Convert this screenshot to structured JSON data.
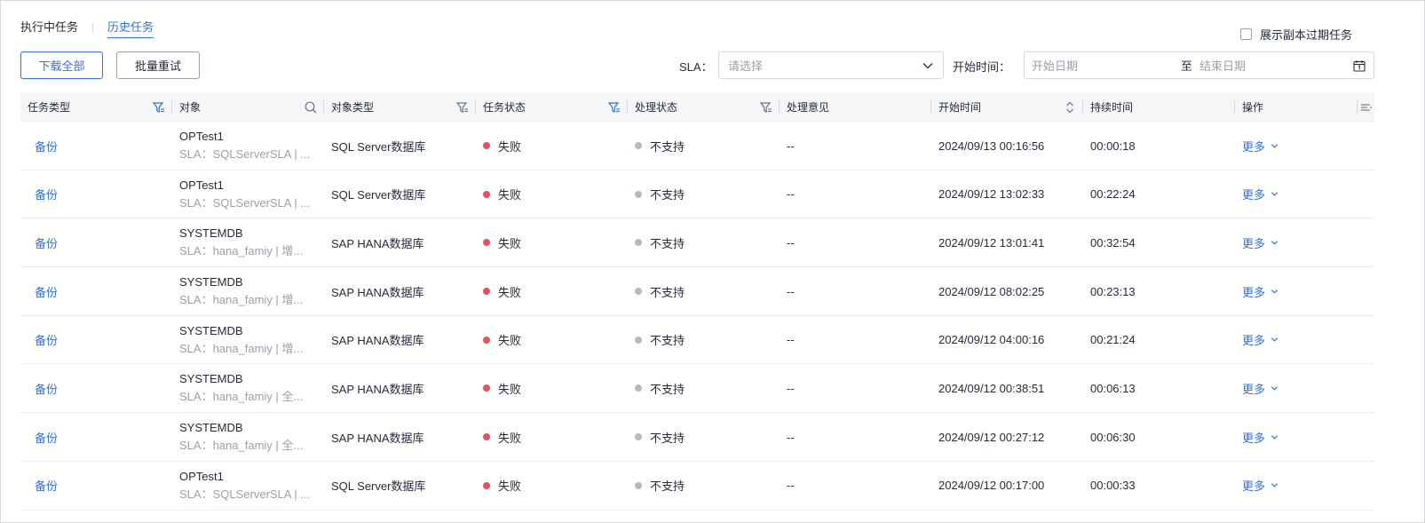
{
  "tabs": [
    {
      "label": "执行中任务",
      "active": false
    },
    {
      "label": "历史任务",
      "active": true
    }
  ],
  "expired_toggle": {
    "label": "展示副本过期任务",
    "checked": false
  },
  "toolbar": {
    "download_all": "下载全部",
    "batch_retry": "批量重试",
    "sla_label": "SLA：",
    "sla_placeholder": "请选择",
    "start_time_label": "开始时间：",
    "start_date_placeholder": "开始日期",
    "range_separator": "至",
    "end_date_placeholder": "结束日期"
  },
  "table": {
    "columns": [
      "任务类型",
      "对象",
      "对象类型",
      "任务状态",
      "处理状态",
      "处理意见",
      "开始时间",
      "持续时间",
      "操作"
    ],
    "rows": [
      {
        "type": "备份",
        "object": "OPTest1",
        "sla": "SLA：SQLServerSLA | ...",
        "object_type": "SQL Server数据库",
        "status": "失败",
        "handle": "不支持",
        "opinion": "--",
        "start": "2024/09/13 00:16:56",
        "duration": "00:00:18",
        "action": "更多"
      },
      {
        "type": "备份",
        "object": "OPTest1",
        "sla": "SLA：SQLServerSLA | ...",
        "object_type": "SQL Server数据库",
        "status": "失败",
        "handle": "不支持",
        "opinion": "--",
        "start": "2024/09/12 13:02:33",
        "duration": "00:22:24",
        "action": "更多"
      },
      {
        "type": "备份",
        "object": "SYSTEMDB",
        "sla": "SLA：hana_famiy | 增...",
        "object_type": "SAP HANA数据库",
        "status": "失败",
        "handle": "不支持",
        "opinion": "--",
        "start": "2024/09/12 13:01:41",
        "duration": "00:32:54",
        "action": "更多"
      },
      {
        "type": "备份",
        "object": "SYSTEMDB",
        "sla": "SLA：hana_famiy | 增...",
        "object_type": "SAP HANA数据库",
        "status": "失败",
        "handle": "不支持",
        "opinion": "--",
        "start": "2024/09/12 08:02:25",
        "duration": "00:23:13",
        "action": "更多"
      },
      {
        "type": "备份",
        "object": "SYSTEMDB",
        "sla": "SLA：hana_famiy | 增...",
        "object_type": "SAP HANA数据库",
        "status": "失败",
        "handle": "不支持",
        "opinion": "--",
        "start": "2024/09/12 04:00:16",
        "duration": "00:21:24",
        "action": "更多"
      },
      {
        "type": "备份",
        "object": "SYSTEMDB",
        "sla": "SLA：hana_famiy | 全...",
        "object_type": "SAP HANA数据库",
        "status": "失败",
        "handle": "不支持",
        "opinion": "--",
        "start": "2024/09/12 00:38:51",
        "duration": "00:06:13",
        "action": "更多"
      },
      {
        "type": "备份",
        "object": "SYSTEMDB",
        "sla": "SLA：hana_famiy | 全...",
        "object_type": "SAP HANA数据库",
        "status": "失败",
        "handle": "不支持",
        "opinion": "--",
        "start": "2024/09/12 00:27:12",
        "duration": "00:06:30",
        "action": "更多"
      },
      {
        "type": "备份",
        "object": "OPTest1",
        "sla": "SLA：SQLServerSLA | ...",
        "object_type": "SQL Server数据库",
        "status": "失败",
        "handle": "不支持",
        "opinion": "--",
        "start": "2024/09/12 00:17:00",
        "duration": "00:00:33",
        "action": "更多"
      }
    ]
  },
  "colors": {
    "accent": "#3471d6",
    "fail": "#e9505a",
    "neutral": "#b5b9c2"
  },
  "icons": {
    "filter": "filter-icon",
    "search": "search-icon",
    "sort": "sort-icon",
    "settings": "column-settings-icon",
    "calendar": "calendar-icon",
    "chevron": "chevron-down-icon"
  }
}
